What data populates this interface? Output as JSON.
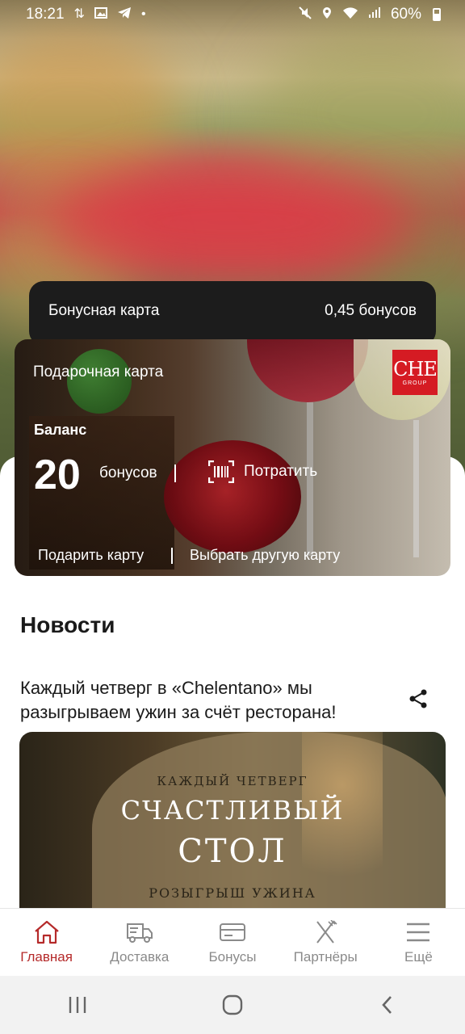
{
  "status_bar": {
    "time": "18:21",
    "battery": "60%",
    "left_icons": [
      "sync-icon",
      "image-icon",
      "telegram-icon",
      "dot-icon"
    ],
    "right_icons": [
      "mute-icon",
      "location-icon",
      "wifi-icon",
      "signal-icon",
      "battery-icon"
    ]
  },
  "bonus_card": {
    "label": "Бонусная карта",
    "value": "0,45 бонусов"
  },
  "gift_card": {
    "title": "Подарочная карта",
    "logo_text": "CHE",
    "logo_subtext": "GROUP",
    "balance_label": "Баланс",
    "balance_value": "20",
    "balance_unit": "бонусов",
    "spend_label": "Потратить",
    "gift_label": "Подарить карту",
    "choose_label": "Выбрать другую карту"
  },
  "news": {
    "heading": "Новости",
    "item_title": "Каждый четверг в «Chelentano» мы разыгрываем ужин за счёт ресторана!",
    "image_text": {
      "line1": "КАЖДЫЙ ЧЕТВЕРГ",
      "line2": "СЧАСТЛИВЫЙ",
      "line3": "СТОЛ",
      "line4": "РОЗЫГРЫШ УЖИНА"
    }
  },
  "bottom_nav": {
    "items": [
      {
        "label": "Главная",
        "icon": "home-icon",
        "active": true
      },
      {
        "label": "Доставка",
        "icon": "delivery-truck-icon",
        "active": false
      },
      {
        "label": "Бонусы",
        "icon": "card-icon",
        "active": false
      },
      {
        "label": "Партнёры",
        "icon": "fork-knife-icon",
        "active": false
      },
      {
        "label": "Ещё",
        "icon": "menu-icon",
        "active": false
      }
    ]
  },
  "colors": {
    "accent": "#b52a2a",
    "logo_red": "#d51b23",
    "dark_card": "#1c1c1c",
    "inactive": "#8a8a8a"
  }
}
